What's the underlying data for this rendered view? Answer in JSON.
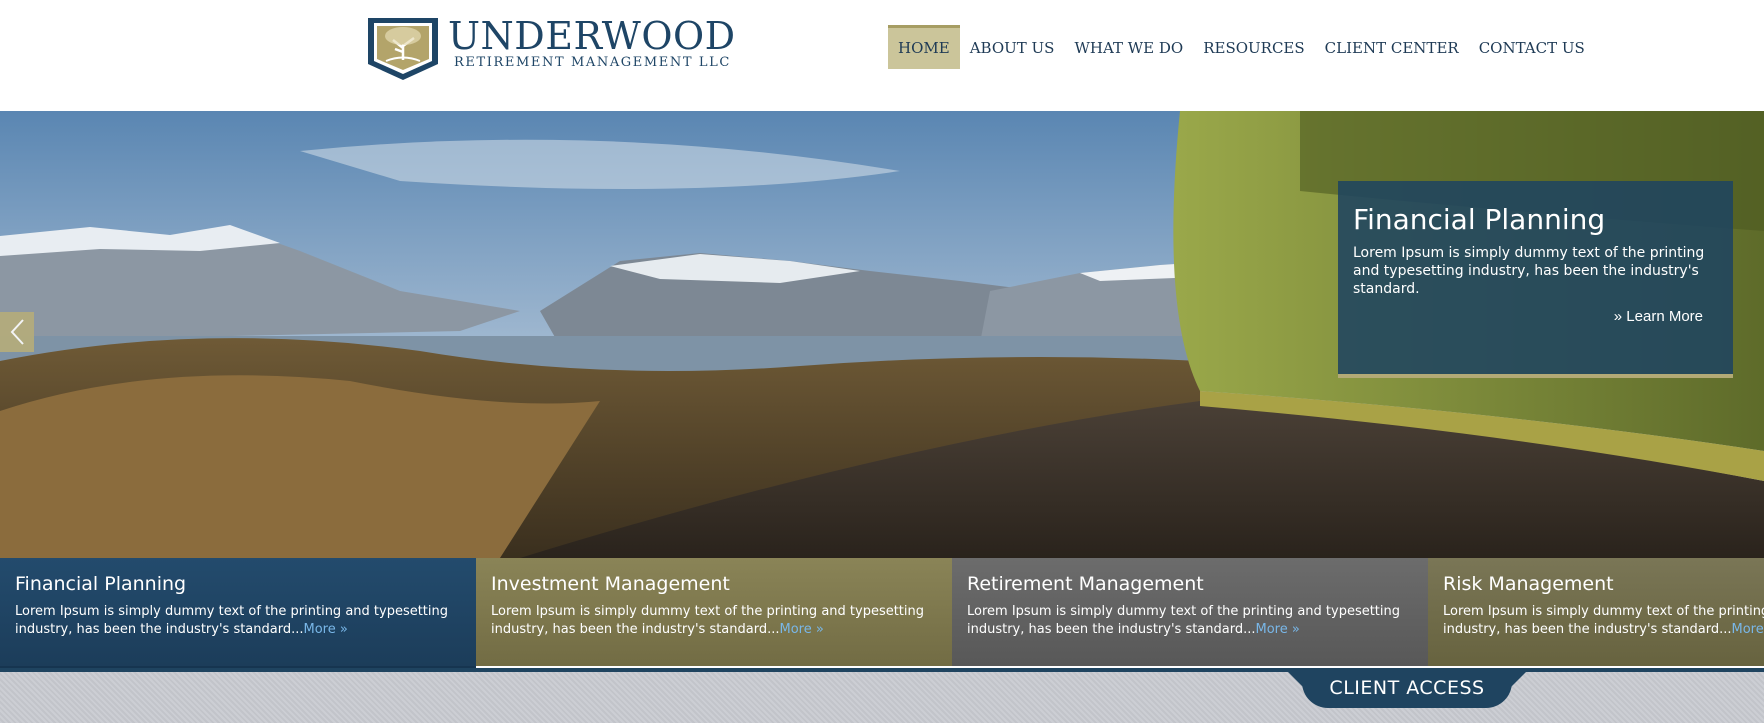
{
  "header": {
    "logo_title": "UNDERWOOD",
    "logo_subtitle": "RETIREMENT MANAGEMENT LLC",
    "nav": [
      {
        "label": "HOME",
        "active": true
      },
      {
        "label": "ABOUT US"
      },
      {
        "label": "WHAT WE DO"
      },
      {
        "label": "RESOURCES"
      },
      {
        "label": "CLIENT CENTER"
      },
      {
        "label": "CONTACT US"
      }
    ]
  },
  "hero": {
    "caption_title": "Financial Planning",
    "caption_text": "Lorem Ipsum is simply dummy text of the printing and typesetting industry, has been the industry's standard.",
    "caption_link": "» Learn More",
    "prev_icon": "chevron-left-icon"
  },
  "tiles": [
    {
      "title": "Financial Planning",
      "text": "Lorem Ipsum is simply dummy text of the printing and typesetting industry, has been the industry's standard...",
      "more": "More »"
    },
    {
      "title": "Investment Management",
      "text": "Lorem Ipsum is simply dummy text of the printing and typesetting industry, has been the industry's standard...",
      "more": "More »"
    },
    {
      "title": "Retirement Management",
      "text": "Lorem Ipsum is simply dummy text of the printing and typesetting industry, has been the industry's standard...",
      "more": "More »"
    },
    {
      "title": "Risk Management",
      "text": "Lorem Ipsum is simply dummy text of the printing and typesetting industry, has been the industry's standard...",
      "more": "More »"
    }
  ],
  "footer": {
    "client_access_label": "CLIENT ACCESS"
  },
  "colors": {
    "navy": "#1f4460",
    "gold": "#cbc59a",
    "olive": "#7a7450",
    "gray": "#626262"
  }
}
